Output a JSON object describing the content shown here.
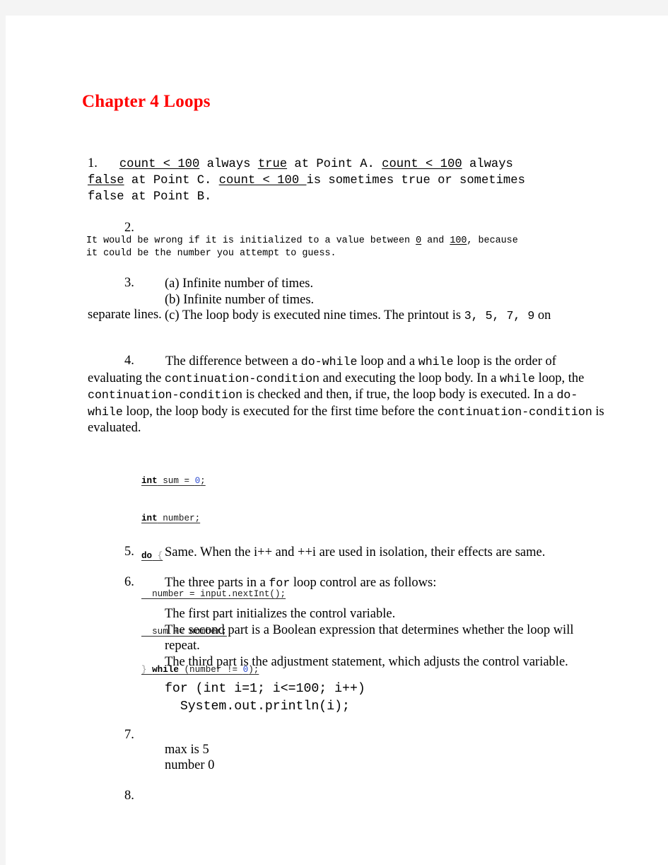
{
  "document": {
    "title": "Chapter 4 Loops",
    "title_color": "#ff0000"
  },
  "items": {
    "n1": "1.",
    "n2": "2.",
    "n3": "3.",
    "n4": "4.",
    "n5": "5.",
    "n6": "6.",
    "n7": "7.",
    "n8": "8."
  },
  "item1": {
    "seg1": "count < 100",
    "seg2": " always ",
    "seg3": "true",
    "seg4": " at Point A. ",
    "seg5": "count < 100",
    "seg6": " always\n",
    "seg7": "false",
    "seg8": " at Point C. ",
    "seg9": "count < 100 ",
    "seg10": "is sometimes true or sometimes\nfalse at Point B."
  },
  "item2": {
    "part1": "It would be wrong if it is initialized to a value between ",
    "zero": "0",
    "part2": " and ",
    "hundred": "100",
    "part3": ", because\nit could be the number you attempt to guess."
  },
  "item3": {
    "a": "(a) Infinite number of times.",
    "b": "(b) Infinite number of times.",
    "c_before": "(c) The loop body is executed nine times. The printout is ",
    "c_code": "3, 5, 7, 9",
    "c_after": " on",
    "tail": "separate lines."
  },
  "item4": {
    "t1": "The difference between a ",
    "c1": "do-while",
    "t2": " loop and a ",
    "c2": "while",
    "t3": " loop is the order of evaluating the ",
    "c3": "continuation-condition",
    "t4": " and executing the loop body. In a ",
    "c4": "while",
    "t5": " loop, the ",
    "c5": "continuation-condition",
    "t6": " is checked and then, if true, the loop body is executed. In a ",
    "c6": "do-while",
    "t7": " loop, the loop body is executed for the first time before the ",
    "c7": "continuation-condition",
    "t8": " is evaluated."
  },
  "code_dowhile": {
    "line1_kw": "int",
    "line1_mid": " sum = ",
    "line1_num": "0",
    "line1_end": ";",
    "line2_kw": "int",
    "line2_rest": " number;",
    "line3_kw": "do",
    "line3_brace": " {",
    "line4": "  number = input.nextInt();",
    "line5": "  sum += number;",
    "line6_brace": "} ",
    "line6_kw": "while",
    "line6_mid": " (number != ",
    "line6_num": "0",
    "line6_end": ");"
  },
  "item5": {
    "text": "Same. When the i++ and ++i are used in isolation, their effects are same."
  },
  "item6": {
    "lead_before": "The three parts in a ",
    "lead_code": "for",
    "lead_after": " loop control are as follows:",
    "part1": "The first part initializes the control variable.",
    "part2": "The second part is a Boolean expression that determines whether the loop will repeat.",
    "part3": "The third part is the adjustment statement, which adjusts the control variable."
  },
  "code_for": {
    "line1": "for (int i=1; i<=100; i++)",
    "line2": "  System.out.println(i);"
  },
  "item7": {
    "line1": "max is 5",
    "line2": "number 0"
  }
}
